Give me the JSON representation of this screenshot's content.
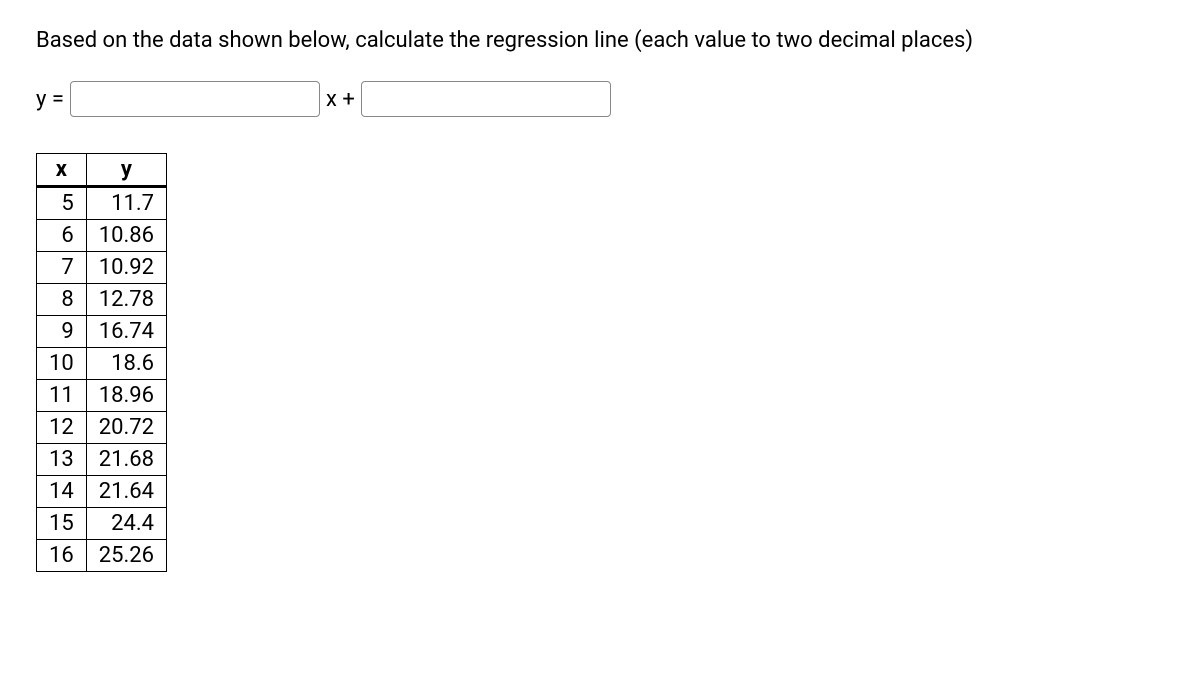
{
  "question": "Based on the data shown below, calculate the regression line (each value to two decimal places)",
  "equation": {
    "y_equals": "y =",
    "x_plus": "x +",
    "slope_value": "",
    "intercept_value": ""
  },
  "table": {
    "headers": {
      "x": "x",
      "y": "y"
    },
    "rows": [
      {
        "x": "5",
        "y": "11.7"
      },
      {
        "x": "6",
        "y": "10.86"
      },
      {
        "x": "7",
        "y": "10.92"
      },
      {
        "x": "8",
        "y": "12.78"
      },
      {
        "x": "9",
        "y": "16.74"
      },
      {
        "x": "10",
        "y": "18.6"
      },
      {
        "x": "11",
        "y": "18.96"
      },
      {
        "x": "12",
        "y": "20.72"
      },
      {
        "x": "13",
        "y": "21.68"
      },
      {
        "x": "14",
        "y": "21.64"
      },
      {
        "x": "15",
        "y": "24.4"
      },
      {
        "x": "16",
        "y": "25.26"
      }
    ]
  }
}
